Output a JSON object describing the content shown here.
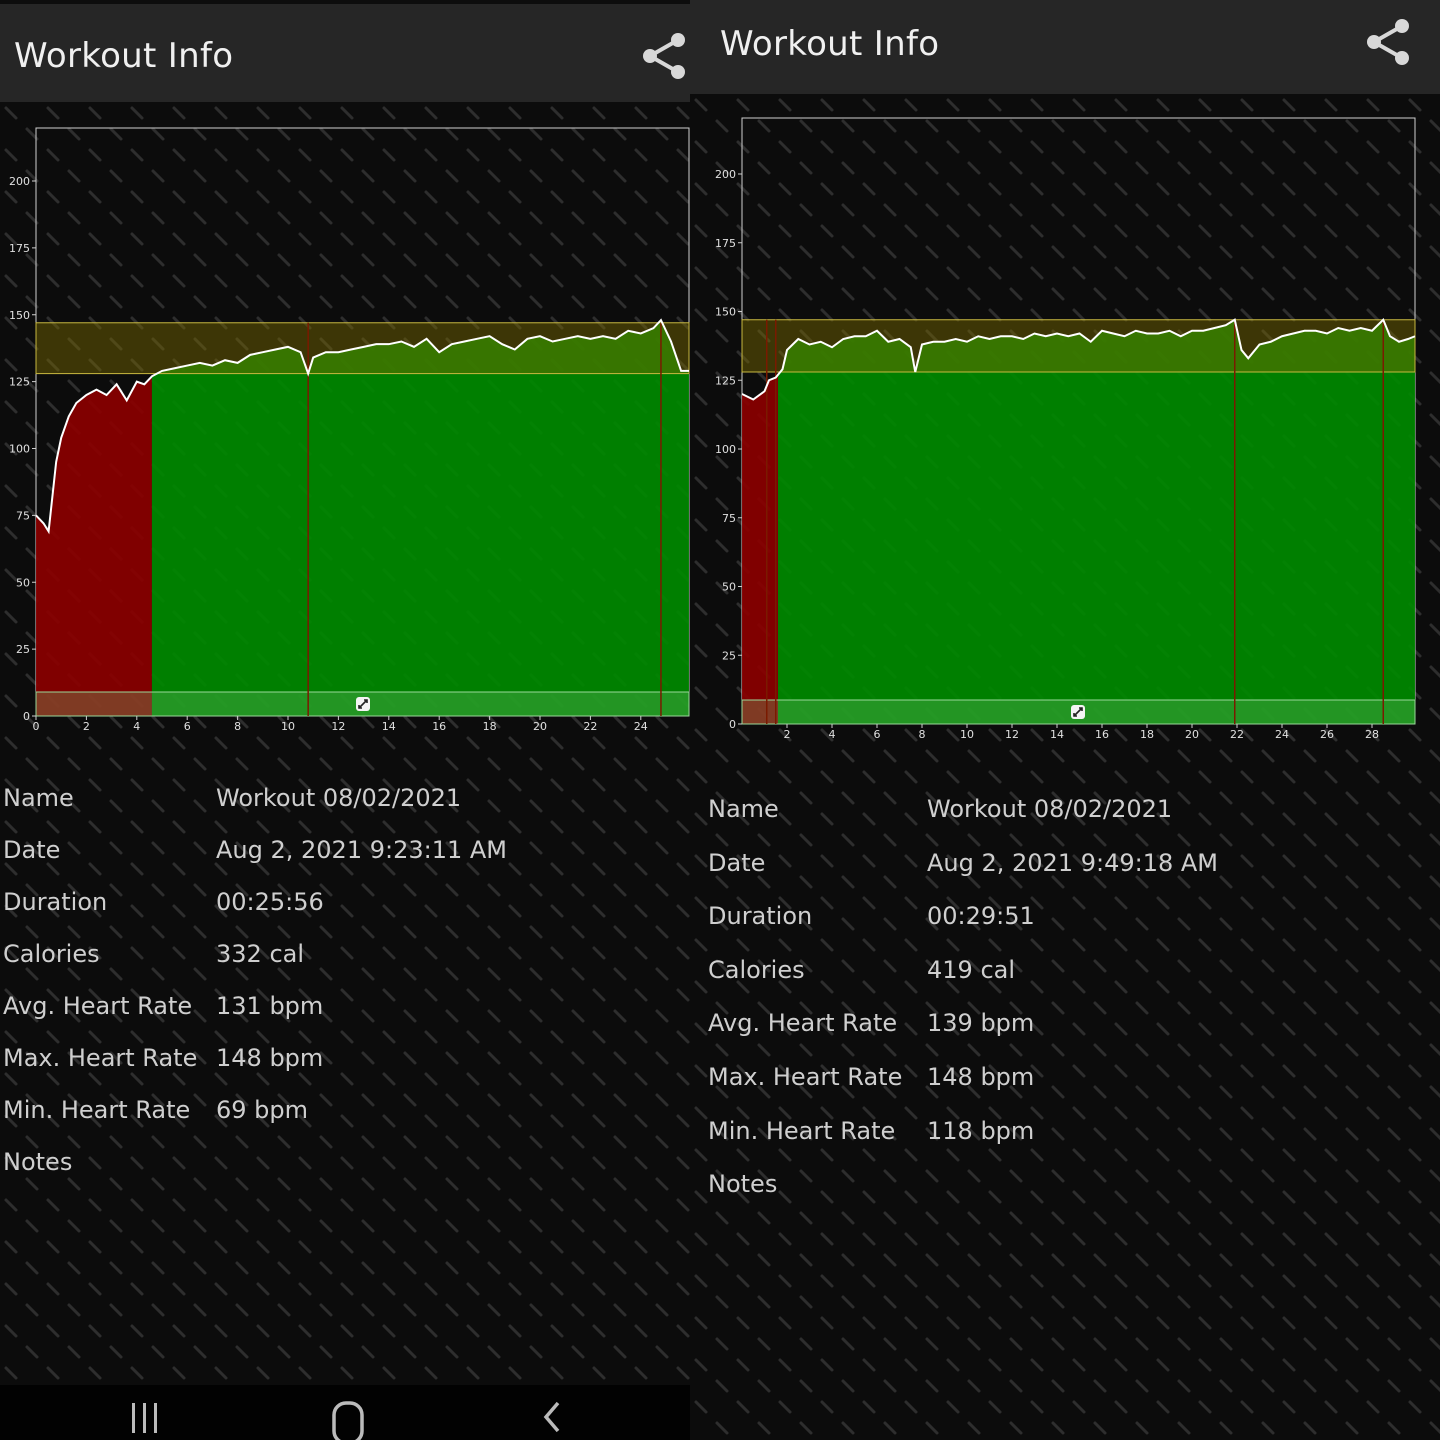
{
  "left": {
    "title": "Workout Info",
    "chart_data": {
      "type": "area",
      "ylim": [
        0,
        220
      ],
      "xlim": [
        0,
        26
      ],
      "yticks": [
        "0",
        "25",
        "50",
        "75",
        "100",
        "125",
        "150",
        "175",
        "200"
      ],
      "xticks": [
        "0",
        "2",
        "4",
        "6",
        "8",
        "10",
        "12",
        "14",
        "16",
        "18",
        "20",
        "22",
        "24"
      ],
      "target_band": [
        128,
        147
      ],
      "zone_change": 4.6,
      "markers": [
        10.8,
        24.8
      ],
      "series": [
        {
          "x": [
            0,
            0.3,
            0.5,
            0.8,
            1,
            1.3,
            1.6,
            2,
            2.4,
            2.8,
            3.2,
            3.6,
            4,
            4.3,
            4.6,
            5,
            5.5,
            6,
            6.5,
            7,
            7.5,
            8,
            8.5,
            9,
            9.5,
            10,
            10.5,
            10.8,
            11,
            11.5,
            12,
            12.5,
            13,
            13.5,
            14,
            14.5,
            15,
            15.5,
            16,
            16.5,
            17,
            17.5,
            18,
            18.5,
            19,
            19.5,
            20,
            20.5,
            21,
            21.5,
            22,
            22.5,
            23,
            23.5,
            24,
            24.5,
            24.8,
            25.2,
            25.6,
            26
          ],
          "y": [
            75,
            72,
            69,
            95,
            104,
            112,
            117,
            120,
            122,
            120,
            124,
            118,
            125,
            124,
            127,
            129,
            130,
            131,
            132,
            131,
            133,
            132,
            135,
            136,
            137,
            138,
            136,
            128,
            134,
            136,
            136,
            137,
            138,
            139,
            139,
            140,
            138,
            141,
            136,
            139,
            140,
            141,
            142,
            139,
            137,
            141,
            142,
            140,
            141,
            142,
            141,
            142,
            141,
            144,
            143,
            145,
            148,
            140,
            129,
            129
          ]
        }
      ]
    },
    "info": [
      {
        "label": "Name",
        "value": "Workout 08/02/2021"
      },
      {
        "label": "Date",
        "value": "Aug 2, 2021 9:23:11 AM"
      },
      {
        "label": "Duration",
        "value": "00:25:56"
      },
      {
        "label": "Calories",
        "value": "332 cal"
      },
      {
        "label": "Avg. Heart Rate",
        "value": "131 bpm"
      },
      {
        "label": "Max. Heart Rate",
        "value": "148 bpm"
      },
      {
        "label": "Min. Heart Rate",
        "value": "69 bpm"
      },
      {
        "label": "Notes",
        "value": ""
      }
    ]
  },
  "right": {
    "title": "Workout Info",
    "chart_data": {
      "type": "area",
      "ylim": [
        0,
        220
      ],
      "xlim": [
        0,
        30
      ],
      "yticks": [
        "0",
        "25",
        "50",
        "75",
        "100",
        "125",
        "150",
        "175",
        "200"
      ],
      "xticks": [
        "2",
        "4",
        "6",
        "8",
        "10",
        "12",
        "14",
        "16",
        "18",
        "20",
        "22",
        "24",
        "26",
        "28"
      ],
      "target_band": [
        128,
        147
      ],
      "zone_change": 1.6,
      "markers": [
        1.1,
        1.5,
        21.9,
        28.5
      ],
      "series": [
        {
          "x": [
            0,
            0.5,
            1,
            1.2,
            1.5,
            1.8,
            2,
            2.5,
            3,
            3.5,
            4,
            4.5,
            5,
            5.5,
            6,
            6.5,
            7,
            7.5,
            7.7,
            8,
            8.5,
            9,
            9.5,
            10,
            10.5,
            11,
            11.5,
            12,
            12.5,
            13,
            13.5,
            14,
            14.5,
            15,
            15.5,
            16,
            16.5,
            17,
            17.5,
            18,
            18.5,
            19,
            19.5,
            20,
            20.5,
            21,
            21.5,
            21.9,
            22.2,
            22.5,
            23,
            23.5,
            24,
            24.5,
            25,
            25.5,
            26,
            26.5,
            27,
            27.5,
            28,
            28.5,
            28.8,
            29.2,
            29.6,
            30
          ],
          "y": [
            120,
            118,
            121,
            125,
            126,
            129,
            136,
            140,
            138,
            139,
            137,
            140,
            141,
            141,
            143,
            139,
            140,
            137,
            128,
            138,
            139,
            139,
            140,
            139,
            141,
            140,
            141,
            141,
            140,
            142,
            141,
            142,
            141,
            142,
            139,
            143,
            142,
            141,
            143,
            142,
            142,
            143,
            141,
            143,
            143,
            144,
            145,
            147,
            136,
            133,
            138,
            139,
            141,
            142,
            143,
            143,
            142,
            144,
            143,
            144,
            143,
            147,
            141,
            139,
            140,
            141
          ]
        }
      ]
    },
    "info": [
      {
        "label": "Name",
        "value": "Workout 08/02/2021"
      },
      {
        "label": "Date",
        "value": "Aug 2, 2021 9:49:18 AM"
      },
      {
        "label": "Duration",
        "value": "00:29:51"
      },
      {
        "label": "Calories",
        "value": "419 cal"
      },
      {
        "label": "Avg. Heart Rate",
        "value": "139 bpm"
      },
      {
        "label": "Max. Heart Rate",
        "value": "148 bpm"
      },
      {
        "label": "Min. Heart Rate",
        "value": "118 bpm"
      },
      {
        "label": "Notes",
        "value": ""
      }
    ]
  },
  "colors": {
    "below_zone": "#8b0000",
    "in_zone": "#008a00",
    "band": "#7a6a00",
    "line": "#ffffff",
    "topbar": "#262626"
  },
  "icons": {
    "share": "share-icon",
    "fullscreen": "expand-icon",
    "nav_recents": "recents-icon",
    "nav_home": "home-icon",
    "nav_back": "back-icon"
  }
}
